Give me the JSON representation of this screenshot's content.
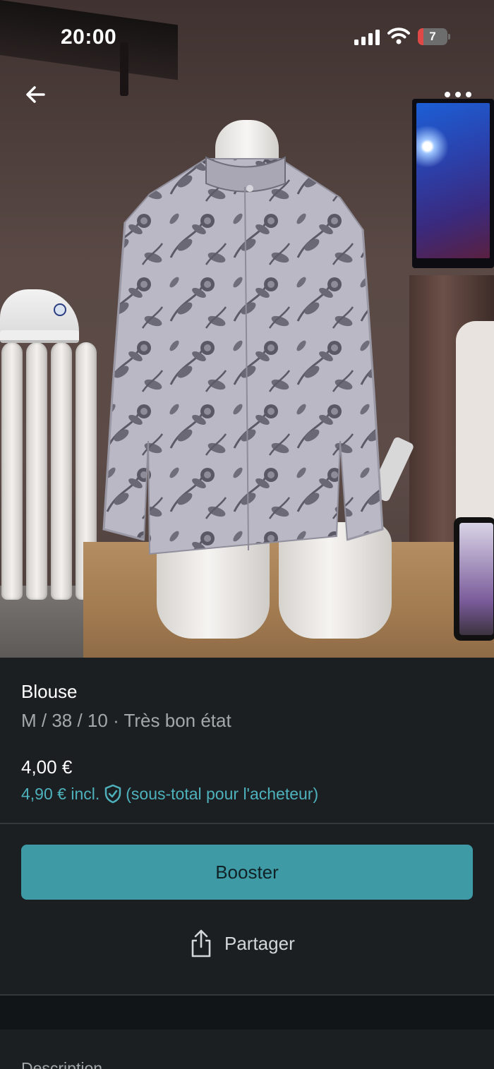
{
  "status_bar": {
    "time": "20:00",
    "battery_level": "7",
    "signal_icon": "cellular-signal-icon",
    "wifi_icon": "wifi-icon",
    "battery_color": "#e04848"
  },
  "nav": {
    "back_icon": "arrow-left-icon",
    "more_icon": "more-horizontal-icon"
  },
  "item": {
    "title": "Blouse",
    "subtitle": "M / 38 / 10 · Très bon état",
    "price": "4,00 €",
    "price_incl": "4,90 € incl.",
    "price_incl_note": "(sous-total pour l'acheteur)",
    "protection_icon": "shield-check-icon"
  },
  "actions": {
    "booster_label": "Booster",
    "share_label": "Partager",
    "share_icon": "share-icon"
  },
  "description": {
    "label": "Description"
  },
  "colors": {
    "background": "#1b1f22",
    "accent": "#3e9ba6",
    "accent_text": "#4eb2bd",
    "muted_text": "#a4a8ab"
  }
}
